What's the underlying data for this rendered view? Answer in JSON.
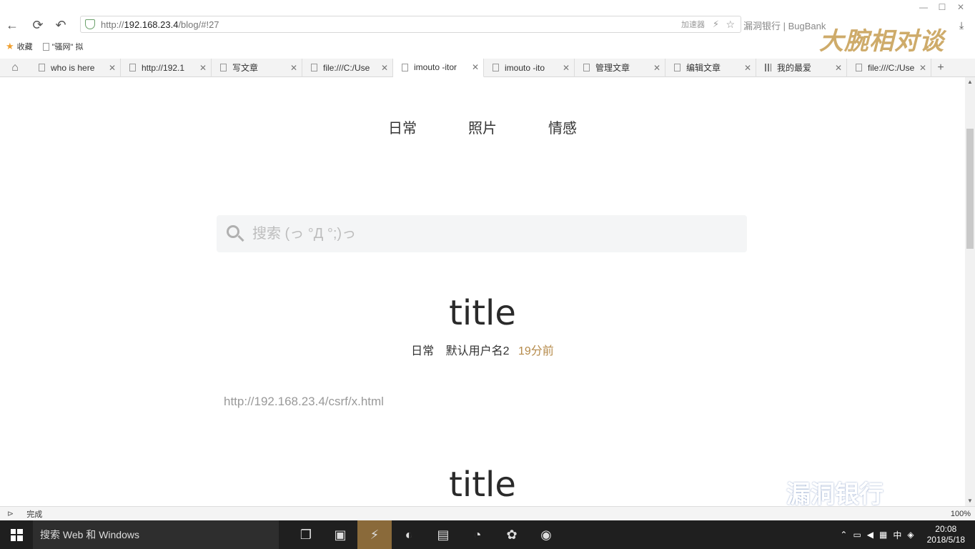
{
  "window": {
    "minimize": "—",
    "maximize": "☐",
    "close": "✕"
  },
  "navbar": {
    "back": "←",
    "refresh": "⟳",
    "undo": "↶",
    "url_proto": "http://",
    "url_host": "192.168.23.4",
    "url_path": "/blog/#!27",
    "accelerator": "加速器",
    "right_text": "漏洞银行 | BugBank",
    "download": "⤓"
  },
  "bookmarks": {
    "favorites": "收藏",
    "item1": "\"骚网\" 拟"
  },
  "tabs": [
    {
      "label": "who is here",
      "close": "✕",
      "active": false
    },
    {
      "label": "http://192.1",
      "close": "✕",
      "active": false
    },
    {
      "label": "写文章",
      "close": "✕",
      "active": false
    },
    {
      "label": "file:///C:/Use",
      "close": "✕",
      "active": false
    },
    {
      "label": "imouto -itor",
      "close": "✕",
      "active": true
    },
    {
      "label": "imouto -ito",
      "close": "✕",
      "active": false
    },
    {
      "label": "管理文章",
      "close": "✕",
      "active": false
    },
    {
      "label": "编辑文章",
      "close": "✕",
      "active": false
    },
    {
      "label": "我的最爱",
      "close": "✕",
      "active": false
    },
    {
      "label": "file:///C:/Use",
      "close": "✕",
      "active": false
    }
  ],
  "watermark": "大腕相对谈",
  "menu": [
    "日常",
    "照片",
    "情感"
  ],
  "search": {
    "placeholder": "搜索 (っ °Д °;)っ"
  },
  "posts": [
    {
      "title": "title",
      "category": "日常",
      "author": "默认用户名2",
      "time": "19分前",
      "body": "http://192.168.23.4/csrf/x.html"
    },
    {
      "title": "title"
    }
  ],
  "statusbar": {
    "status": "完成",
    "zoom": "100%"
  },
  "bugbank_logo": "漏洞银行",
  "taskbar": {
    "search_text": "搜索 Web 和 Windows",
    "time": "20:08",
    "date": "2018/5/18",
    "ime": "中"
  }
}
